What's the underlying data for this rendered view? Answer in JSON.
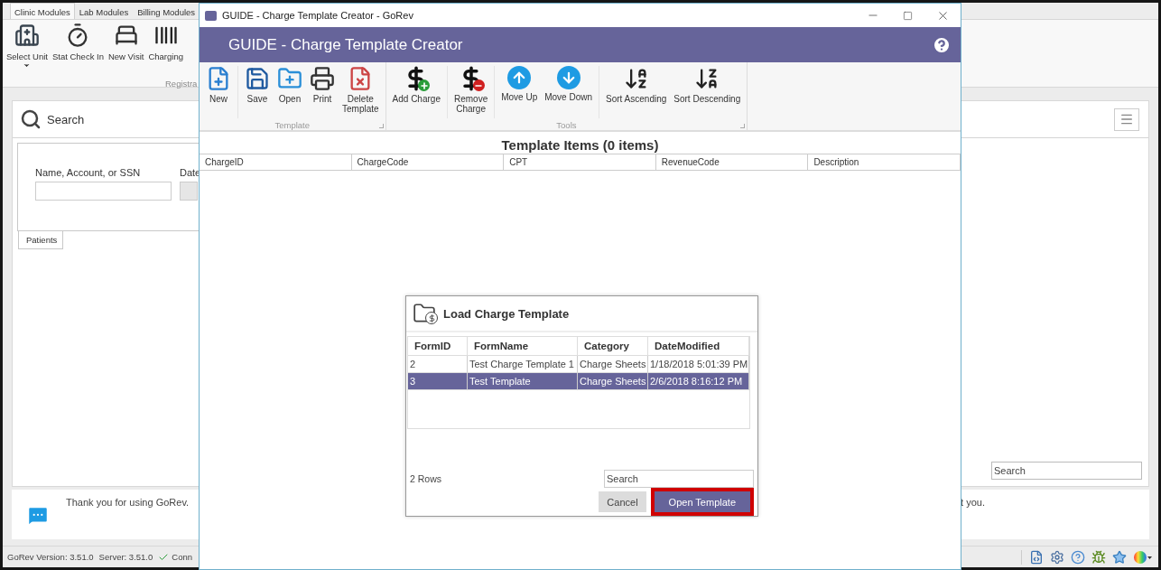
{
  "app": {
    "tabs": [
      {
        "label": "Clinic Modules",
        "selected": true
      },
      {
        "label": "Lab Modules",
        "selected": false
      },
      {
        "label": "Billing Modules",
        "selected": false
      }
    ],
    "ribbon_buttons": [
      {
        "label": "Select Unit",
        "dropdown": true
      },
      {
        "label": "Stat Check In",
        "dropdown": false
      },
      {
        "label": "New Visit",
        "dropdown": false
      },
      {
        "label": "Charging",
        "dropdown": false
      }
    ],
    "ribbon_group": "Registra",
    "search_panel": {
      "title": "Search",
      "field_label": "Name, Account, or SSN",
      "date_label": "Date",
      "tab": "Patients",
      "search_field": {
        "placeholder": "Search"
      }
    },
    "message": {
      "left": "Thank you for using GoRev.",
      "right": "t you."
    },
    "status_bar": {
      "version": "GoRev Version: 3.51.0",
      "server": "Server: 3.51.0",
      "connection": "Conn"
    }
  },
  "window": {
    "title": "GUIDE - Charge Template Creator - GoRev",
    "header": "GUIDE - Charge Template Creator",
    "ribbon": [
      {
        "label": "Template",
        "clusters": [
          [
            "New"
          ],
          [
            "Save",
            "Open",
            "Print",
            "Delete\nTemplate"
          ]
        ]
      },
      {
        "label": "Tools",
        "clusters": [
          [
            "Add Charge"
          ],
          [
            "Remove\nCharge"
          ],
          [
            "Move Up",
            "Move Down"
          ],
          [
            "Sort Ascending",
            "Sort Descending"
          ]
        ]
      }
    ],
    "items_title": "Template Items (0 items)",
    "columns": [
      "ChargeID",
      "ChargeCode",
      "CPT",
      "RevenueCode",
      "Description"
    ]
  },
  "dialog": {
    "title": "Load Charge Template",
    "columns": [
      "FormID",
      "FormName",
      "Category",
      "DateModified"
    ],
    "rows": [
      {
        "cells": [
          "2",
          "Test Charge Template 1",
          "Charge Sheets",
          "1/18/2018 5:01:39 PM"
        ],
        "selected": false
      },
      {
        "cells": [
          "3",
          "Test Template",
          "Charge Sheets",
          "2/6/2018 8:16:12 PM"
        ],
        "selected": true
      }
    ],
    "row_count": "2 Rows",
    "search": {
      "placeholder": "Search"
    },
    "buttons": [
      {
        "label": "Cancel",
        "kind": "secondary",
        "highlighted": false
      },
      {
        "label": "Open Template",
        "kind": "primary",
        "highlighted": true
      }
    ]
  }
}
